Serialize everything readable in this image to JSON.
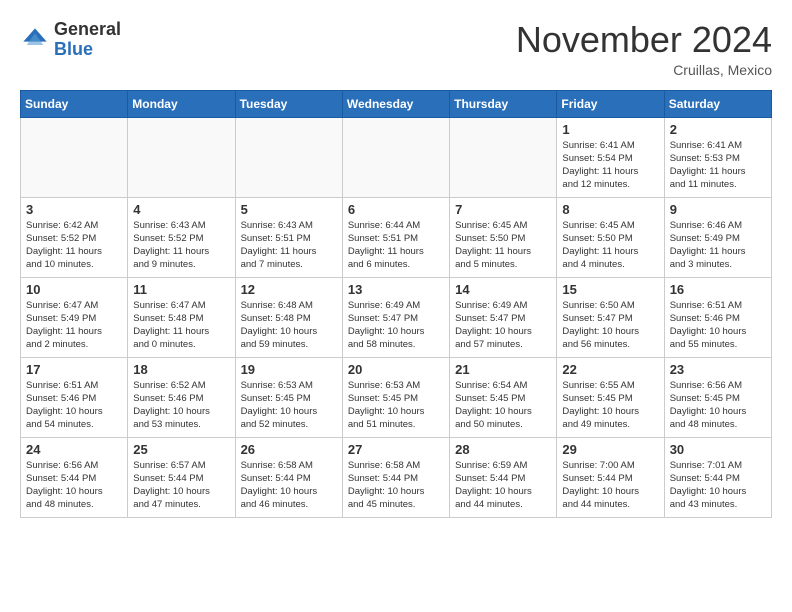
{
  "header": {
    "logo": {
      "line1": "General",
      "line2": "Blue"
    },
    "month": "November 2024",
    "location": "Cruillas, Mexico"
  },
  "weekdays": [
    "Sunday",
    "Monday",
    "Tuesday",
    "Wednesday",
    "Thursday",
    "Friday",
    "Saturday"
  ],
  "weeks": [
    [
      {
        "day": "",
        "info": ""
      },
      {
        "day": "",
        "info": ""
      },
      {
        "day": "",
        "info": ""
      },
      {
        "day": "",
        "info": ""
      },
      {
        "day": "",
        "info": ""
      },
      {
        "day": "1",
        "info": "Sunrise: 6:41 AM\nSunset: 5:54 PM\nDaylight: 11 hours\nand 12 minutes."
      },
      {
        "day": "2",
        "info": "Sunrise: 6:41 AM\nSunset: 5:53 PM\nDaylight: 11 hours\nand 11 minutes."
      }
    ],
    [
      {
        "day": "3",
        "info": "Sunrise: 6:42 AM\nSunset: 5:52 PM\nDaylight: 11 hours\nand 10 minutes."
      },
      {
        "day": "4",
        "info": "Sunrise: 6:43 AM\nSunset: 5:52 PM\nDaylight: 11 hours\nand 9 minutes."
      },
      {
        "day": "5",
        "info": "Sunrise: 6:43 AM\nSunset: 5:51 PM\nDaylight: 11 hours\nand 7 minutes."
      },
      {
        "day": "6",
        "info": "Sunrise: 6:44 AM\nSunset: 5:51 PM\nDaylight: 11 hours\nand 6 minutes."
      },
      {
        "day": "7",
        "info": "Sunrise: 6:45 AM\nSunset: 5:50 PM\nDaylight: 11 hours\nand 5 minutes."
      },
      {
        "day": "8",
        "info": "Sunrise: 6:45 AM\nSunset: 5:50 PM\nDaylight: 11 hours\nand 4 minutes."
      },
      {
        "day": "9",
        "info": "Sunrise: 6:46 AM\nSunset: 5:49 PM\nDaylight: 11 hours\nand 3 minutes."
      }
    ],
    [
      {
        "day": "10",
        "info": "Sunrise: 6:47 AM\nSunset: 5:49 PM\nDaylight: 11 hours\nand 2 minutes."
      },
      {
        "day": "11",
        "info": "Sunrise: 6:47 AM\nSunset: 5:48 PM\nDaylight: 11 hours\nand 0 minutes."
      },
      {
        "day": "12",
        "info": "Sunrise: 6:48 AM\nSunset: 5:48 PM\nDaylight: 10 hours\nand 59 minutes."
      },
      {
        "day": "13",
        "info": "Sunrise: 6:49 AM\nSunset: 5:47 PM\nDaylight: 10 hours\nand 58 minutes."
      },
      {
        "day": "14",
        "info": "Sunrise: 6:49 AM\nSunset: 5:47 PM\nDaylight: 10 hours\nand 57 minutes."
      },
      {
        "day": "15",
        "info": "Sunrise: 6:50 AM\nSunset: 5:47 PM\nDaylight: 10 hours\nand 56 minutes."
      },
      {
        "day": "16",
        "info": "Sunrise: 6:51 AM\nSunset: 5:46 PM\nDaylight: 10 hours\nand 55 minutes."
      }
    ],
    [
      {
        "day": "17",
        "info": "Sunrise: 6:51 AM\nSunset: 5:46 PM\nDaylight: 10 hours\nand 54 minutes."
      },
      {
        "day": "18",
        "info": "Sunrise: 6:52 AM\nSunset: 5:46 PM\nDaylight: 10 hours\nand 53 minutes."
      },
      {
        "day": "19",
        "info": "Sunrise: 6:53 AM\nSunset: 5:45 PM\nDaylight: 10 hours\nand 52 minutes."
      },
      {
        "day": "20",
        "info": "Sunrise: 6:53 AM\nSunset: 5:45 PM\nDaylight: 10 hours\nand 51 minutes."
      },
      {
        "day": "21",
        "info": "Sunrise: 6:54 AM\nSunset: 5:45 PM\nDaylight: 10 hours\nand 50 minutes."
      },
      {
        "day": "22",
        "info": "Sunrise: 6:55 AM\nSunset: 5:45 PM\nDaylight: 10 hours\nand 49 minutes."
      },
      {
        "day": "23",
        "info": "Sunrise: 6:56 AM\nSunset: 5:45 PM\nDaylight: 10 hours\nand 48 minutes."
      }
    ],
    [
      {
        "day": "24",
        "info": "Sunrise: 6:56 AM\nSunset: 5:44 PM\nDaylight: 10 hours\nand 48 minutes."
      },
      {
        "day": "25",
        "info": "Sunrise: 6:57 AM\nSunset: 5:44 PM\nDaylight: 10 hours\nand 47 minutes."
      },
      {
        "day": "26",
        "info": "Sunrise: 6:58 AM\nSunset: 5:44 PM\nDaylight: 10 hours\nand 46 minutes."
      },
      {
        "day": "27",
        "info": "Sunrise: 6:58 AM\nSunset: 5:44 PM\nDaylight: 10 hours\nand 45 minutes."
      },
      {
        "day": "28",
        "info": "Sunrise: 6:59 AM\nSunset: 5:44 PM\nDaylight: 10 hours\nand 44 minutes."
      },
      {
        "day": "29",
        "info": "Sunrise: 7:00 AM\nSunset: 5:44 PM\nDaylight: 10 hours\nand 44 minutes."
      },
      {
        "day": "30",
        "info": "Sunrise: 7:01 AM\nSunset: 5:44 PM\nDaylight: 10 hours\nand 43 minutes."
      }
    ]
  ]
}
